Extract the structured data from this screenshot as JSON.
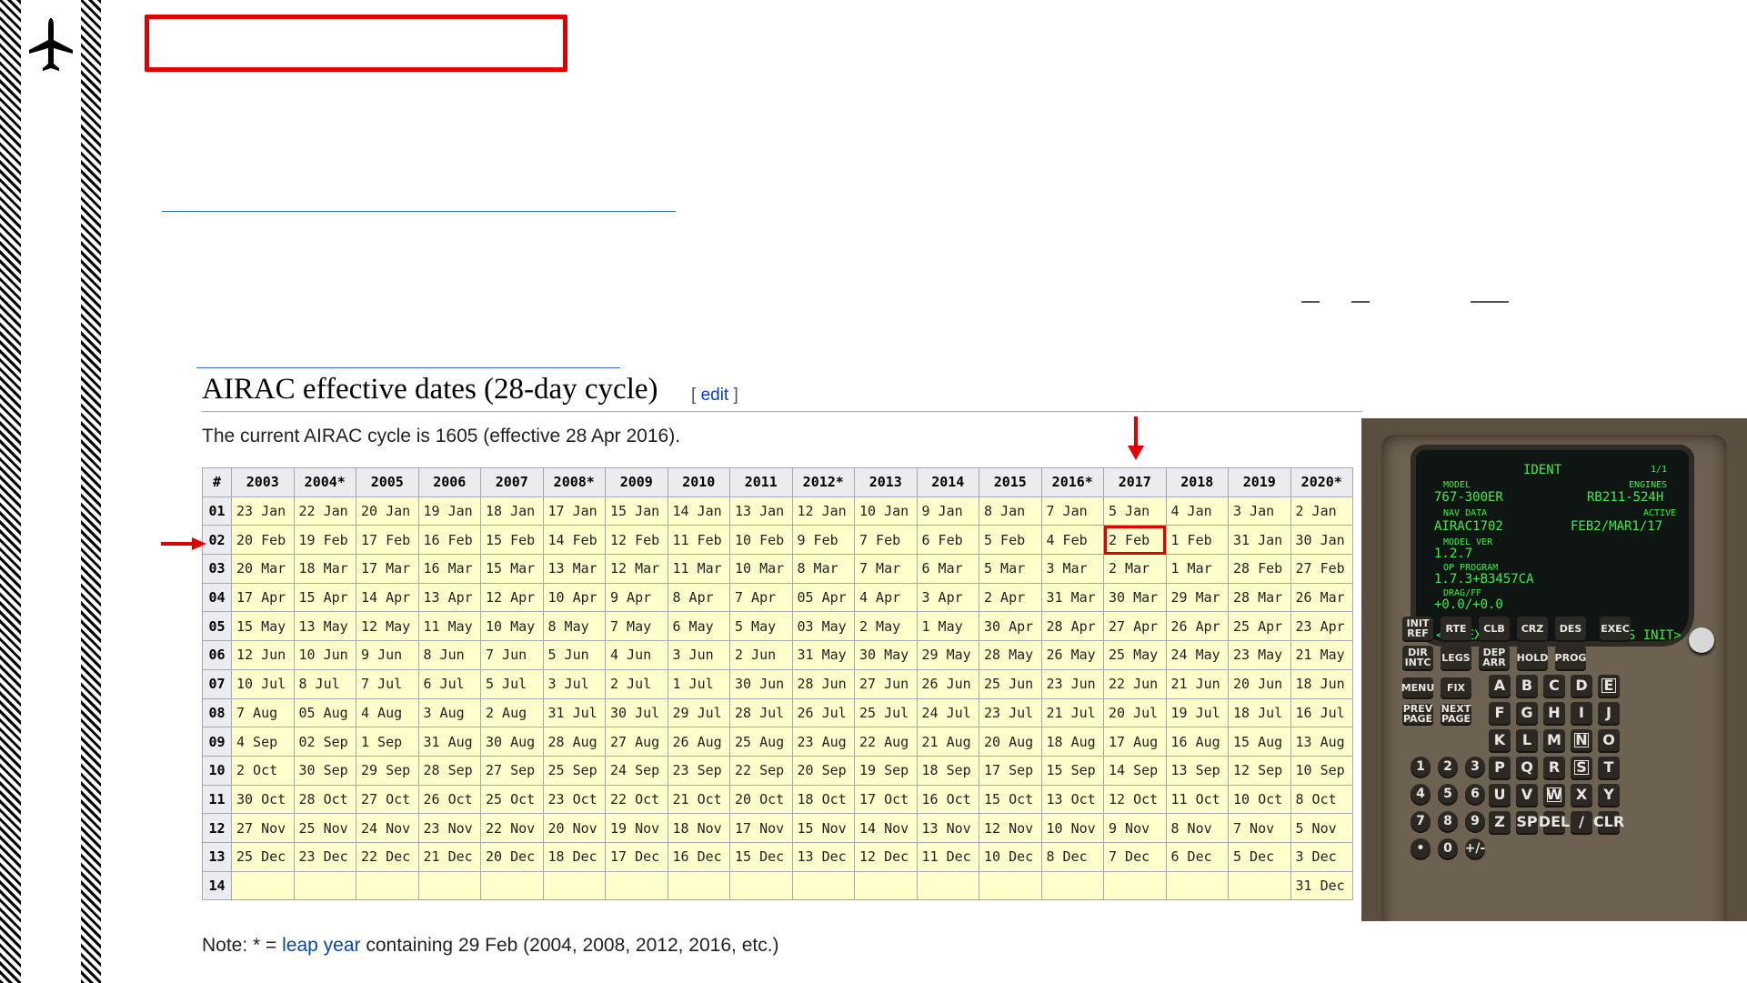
{
  "heading": "AIRAC effective dates (28-day cycle)",
  "edit_open": "[ ",
  "edit_label": "edit",
  "edit_close": " ]",
  "current_text": "The current AIRAC cycle is 1605 (effective 28 Apr 2016).",
  "table": {
    "corner": "#",
    "years": [
      "2003",
      "2004*",
      "2005",
      "2006",
      "2007",
      "2008*",
      "2009",
      "2010",
      "2011",
      "2012*",
      "2013",
      "2014",
      "2015",
      "2016*",
      "2017",
      "2018",
      "2019",
      "2020*"
    ],
    "rows": [
      {
        "num": "01",
        "cells": [
          "23 Jan",
          "22 Jan",
          "20 Jan",
          "19 Jan",
          "18 Jan",
          "17 Jan",
          "15 Jan",
          "14 Jan",
          "13 Jan",
          "12 Jan",
          "10 Jan",
          "9 Jan",
          "8 Jan",
          "7 Jan",
          "5 Jan",
          "4 Jan",
          "3 Jan",
          "2 Jan"
        ]
      },
      {
        "num": "02",
        "cells": [
          "20 Feb",
          "19 Feb",
          "17 Feb",
          "16 Feb",
          "15 Feb",
          "14 Feb",
          "12 Feb",
          "11 Feb",
          "10 Feb",
          "9 Feb",
          "7 Feb",
          "6 Feb",
          "5 Feb",
          "4 Feb",
          "2 Feb",
          "1 Feb",
          "31 Jan",
          "30 Jan"
        ]
      },
      {
        "num": "03",
        "cells": [
          "20 Mar",
          "18 Mar",
          "17 Mar",
          "16 Mar",
          "15 Mar",
          "13 Mar",
          "12 Mar",
          "11 Mar",
          "10 Mar",
          "8 Mar",
          "7 Mar",
          "6 Mar",
          "5 Mar",
          "3 Mar",
          "2 Mar",
          "1 Mar",
          "28 Feb",
          "27 Feb"
        ]
      },
      {
        "num": "04",
        "cells": [
          "17 Apr",
          "15 Apr",
          "14 Apr",
          "13 Apr",
          "12 Apr",
          "10 Apr",
          "9 Apr",
          "8 Apr",
          "7 Apr",
          "05 Apr",
          "4 Apr",
          "3 Apr",
          "2 Apr",
          "31 Mar",
          "30 Mar",
          "29 Mar",
          "28 Mar",
          "26 Mar"
        ]
      },
      {
        "num": "05",
        "cells": [
          "15 May",
          "13 May",
          "12 May",
          "11 May",
          "10 May",
          "8 May",
          "7 May",
          "6 May",
          "5 May",
          "03 May",
          "2 May",
          "1 May",
          "30 Apr",
          "28 Apr",
          "27 Apr",
          "26 Apr",
          "25 Apr",
          "23 Apr"
        ]
      },
      {
        "num": "06",
        "cells": [
          "12 Jun",
          "10 Jun",
          "9 Jun",
          "8 Jun",
          "7 Jun",
          "5 Jun",
          "4 Jun",
          "3 Jun",
          "2 Jun",
          "31 May",
          "30 May",
          "29 May",
          "28 May",
          "26 May",
          "25 May",
          "24 May",
          "23 May",
          "21 May"
        ]
      },
      {
        "num": "07",
        "cells": [
          "10 Jul",
          "8 Jul",
          "7 Jul",
          "6 Jul",
          "5 Jul",
          "3 Jul",
          "2 Jul",
          "1 Jul",
          "30 Jun",
          "28 Jun",
          "27 Jun",
          "26 Jun",
          "25 Jun",
          "23 Jun",
          "22 Jun",
          "21 Jun",
          "20 Jun",
          "18 Jun"
        ]
      },
      {
        "num": "08",
        "cells": [
          "7 Aug",
          "05 Aug",
          "4 Aug",
          "3 Aug",
          "2 Aug",
          "31 Jul",
          "30 Jul",
          "29 Jul",
          "28 Jul",
          "26 Jul",
          "25 Jul",
          "24 Jul",
          "23 Jul",
          "21 Jul",
          "20 Jul",
          "19 Jul",
          "18 Jul",
          "16 Jul"
        ]
      },
      {
        "num": "09",
        "cells": [
          "4 Sep",
          "02 Sep",
          "1 Sep",
          "31 Aug",
          "30 Aug",
          "28 Aug",
          "27 Aug",
          "26 Aug",
          "25 Aug",
          "23 Aug",
          "22 Aug",
          "21 Aug",
          "20 Aug",
          "18 Aug",
          "17 Aug",
          "16 Aug",
          "15 Aug",
          "13 Aug"
        ]
      },
      {
        "num": "10",
        "cells": [
          "2 Oct",
          "30 Sep",
          "29 Sep",
          "28 Sep",
          "27 Sep",
          "25 Sep",
          "24 Sep",
          "23 Sep",
          "22 Sep",
          "20 Sep",
          "19 Sep",
          "18 Sep",
          "17 Sep",
          "15 Sep",
          "14 Sep",
          "13 Sep",
          "12 Sep",
          "10 Sep"
        ]
      },
      {
        "num": "11",
        "cells": [
          "30 Oct",
          "28 Oct",
          "27 Oct",
          "26 Oct",
          "25 Oct",
          "23 Oct",
          "22 Oct",
          "21 Oct",
          "20 Oct",
          "18 Oct",
          "17 Oct",
          "16 Oct",
          "15 Oct",
          "13 Oct",
          "12 Oct",
          "11 Oct",
          "10 Oct",
          "8 Oct"
        ]
      },
      {
        "num": "12",
        "cells": [
          "27 Nov",
          "25 Nov",
          "24 Nov",
          "23 Nov",
          "22 Nov",
          "20 Nov",
          "19 Nov",
          "18 Nov",
          "17 Nov",
          "15 Nov",
          "14 Nov",
          "13 Nov",
          "12 Nov",
          "10 Nov",
          "9 Nov",
          "8 Nov",
          "7 Nov",
          "5 Nov"
        ]
      },
      {
        "num": "13",
        "cells": [
          "25 Dec",
          "23 Dec",
          "22 Dec",
          "21 Dec",
          "20 Dec",
          "18 Dec",
          "17 Dec",
          "16 Dec",
          "15 Dec",
          "13 Dec",
          "12 Dec",
          "11 Dec",
          "10 Dec",
          "8 Dec",
          "7 Dec",
          "6 Dec",
          "5 Dec",
          "3 Dec"
        ]
      },
      {
        "num": "14",
        "cells": [
          "",
          "",
          "",
          "",
          "",
          "",
          "",
          "",
          "",
          "",
          "",
          "",
          "",
          "",
          "",
          "",
          "",
          "31 Dec"
        ]
      }
    ]
  },
  "note_prefix": "Note: * = ",
  "note_link": "leap year",
  "note_suffix": " containing 29 Feb (2004, 2008, 2012, 2016, etc.)",
  "highlight_color": "#e00000",
  "fmc": {
    "title": "IDENT",
    "page": "1/1",
    "lbl_model": "MODEL",
    "lbl_engines": "ENGINES",
    "model": "767-300ER",
    "engines": "RB211-524H",
    "lbl_navdata": "NAV DATA",
    "lbl_active": "ACTIVE",
    "navdata": "AIRAC1702",
    "active": "FEB2/MAR1/17",
    "lbl_modelver": "MODEL VER",
    "modelver": "1.2.7",
    "lbl_opprog": "OP PROGRAM",
    "opprog": "1.7.3+B3457CA",
    "lbl_dragff": "DRAG/FF",
    "dragff": "+0.0/+0.0",
    "index": "<INDEX",
    "posinit": "POS INIT>",
    "func_keys": [
      "INIT REF",
      "RTE",
      "CLB",
      "CRZ",
      "DES"
    ],
    "func_keys2": [
      "DIR INTC",
      "LEGS",
      "DEP ARR",
      "HOLD",
      "PROG"
    ],
    "exec": "EXEC",
    "menu": "MENU",
    "fix": "FIX",
    "prev": "PREV PAGE",
    "next": "NEXT PAGE",
    "alpha": [
      "A",
      "B",
      "C",
      "D",
      "E",
      "F",
      "G",
      "H",
      "I",
      "J",
      "K",
      "L",
      "M",
      "N",
      "O",
      "P",
      "Q",
      "R",
      "S",
      "T",
      "U",
      "V",
      "W",
      "X",
      "Y",
      "Z",
      "SP",
      "DEL",
      "/",
      "CLR"
    ],
    "digits": [
      "1",
      "2",
      "3",
      "4",
      "5",
      "6",
      "7",
      "8",
      "9",
      "•",
      "0",
      "+/-"
    ]
  }
}
